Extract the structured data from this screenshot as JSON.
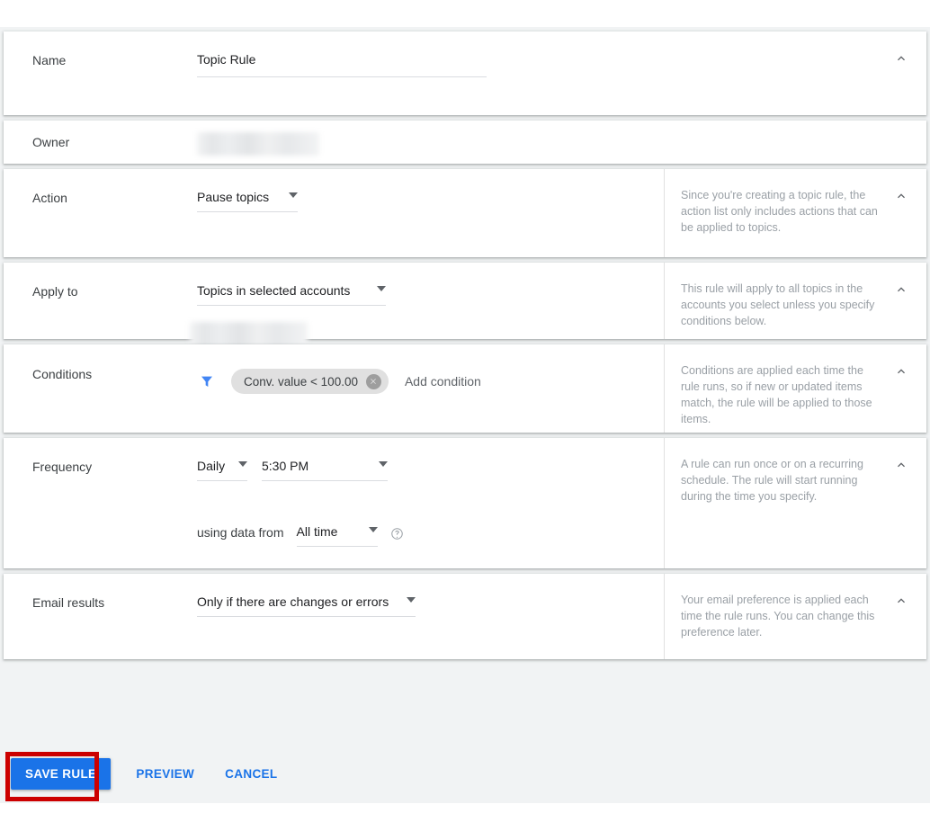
{
  "colors": {
    "accent": "#1a73e8",
    "page_bg": "#f1f3f4",
    "card_bg": "#ffffff",
    "label_text": "#3c4043",
    "hint_text": "#9aa0a6",
    "chip_bg": "#e0e0e0",
    "filter_icon": "#4285f4",
    "annotation_red": "#cc0000"
  },
  "sections": {
    "name": {
      "label": "Name",
      "value": "Topic Rule",
      "placeholder": "Name",
      "collapse_icon": "chevron-up-icon"
    },
    "owner": {
      "label": "Owner",
      "value": "",
      "redacted": true
    },
    "action": {
      "label": "Action",
      "value": "Pause topics",
      "hint": "Since you're creating a topic rule, the action list only includes actions that can be applied to topics.",
      "collapse_icon": "chevron-up-icon"
    },
    "apply_to": {
      "label": "Apply to",
      "value": "Topics in selected accounts",
      "account_value": "",
      "account_redacted": true,
      "hint": "This rule will apply to all topics in the accounts you select unless you specify conditions below.",
      "collapse_icon": "chevron-up-icon"
    },
    "conditions": {
      "label": "Conditions",
      "filter_icon": "filter-icon",
      "chips": [
        {
          "text": "Conv. value < 100.00",
          "remove_icon": "close-icon"
        }
      ],
      "add_label": "Add condition",
      "hint": "Conditions are applied each time the rule runs, so if new or updated items match, the rule will be applied to those items.",
      "collapse_icon": "chevron-up-icon"
    },
    "frequency": {
      "label": "Frequency",
      "interval": "Daily",
      "time": "5:30 PM",
      "using_data_from_label": "using data from",
      "data_range": "All time",
      "help_icon": "help-circle-icon",
      "hint": "A rule can run once or on a recurring schedule. The rule will start running during the time you specify.",
      "collapse_icon": "chevron-up-icon"
    },
    "email_results": {
      "label": "Email results",
      "value": "Only if there are changes or errors",
      "hint": "Your email preference is applied each time the rule runs. You can change this preference later.",
      "collapse_icon": "chevron-up-icon"
    }
  },
  "action_bar": {
    "save_label": "SAVE RULE",
    "preview_label": "PREVIEW",
    "cancel_label": "CANCEL"
  }
}
